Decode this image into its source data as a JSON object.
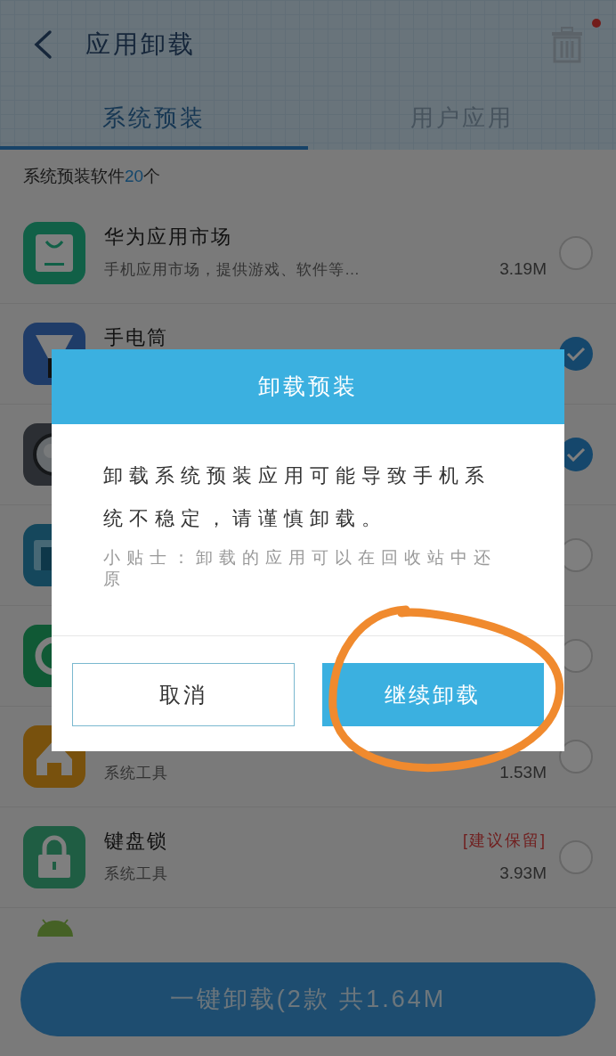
{
  "header": {
    "title": "应用卸载",
    "trash_badge": true
  },
  "tabs": [
    {
      "label": "系统预装",
      "selected": true
    },
    {
      "label": "用户应用",
      "selected": false
    }
  ],
  "section": {
    "before": "系统预装软件",
    "count": "20",
    "after": "个"
  },
  "apps": [
    {
      "name": "华为应用市场",
      "description": "手机应用市场，提供游戏、软件等…",
      "size": "3.19M",
      "checked": false
    },
    {
      "name": "手电筒",
      "checked": true
    },
    {
      "checked": true
    },
    {
      "checked": false
    },
    {
      "checked": false
    },
    {
      "description": "系统工具",
      "size": "1.53M",
      "checked": false
    },
    {
      "name": "键盘锁",
      "description": "系统工具",
      "tag": "[建议保留]",
      "size": "3.93M",
      "checked": false
    }
  ],
  "bottom_button": "一键卸载(2款 共1.64M",
  "dialog": {
    "title": "卸载预装",
    "message": "卸载系统预装应用可能导致手机系统不稳定，请谨慎卸载。",
    "tip": "小贴士：卸载的应用可以在回收站中还原",
    "buttons": [
      {
        "label": "取消",
        "kind": "secondary"
      },
      {
        "label": "继续卸载",
        "kind": "primary"
      }
    ]
  }
}
